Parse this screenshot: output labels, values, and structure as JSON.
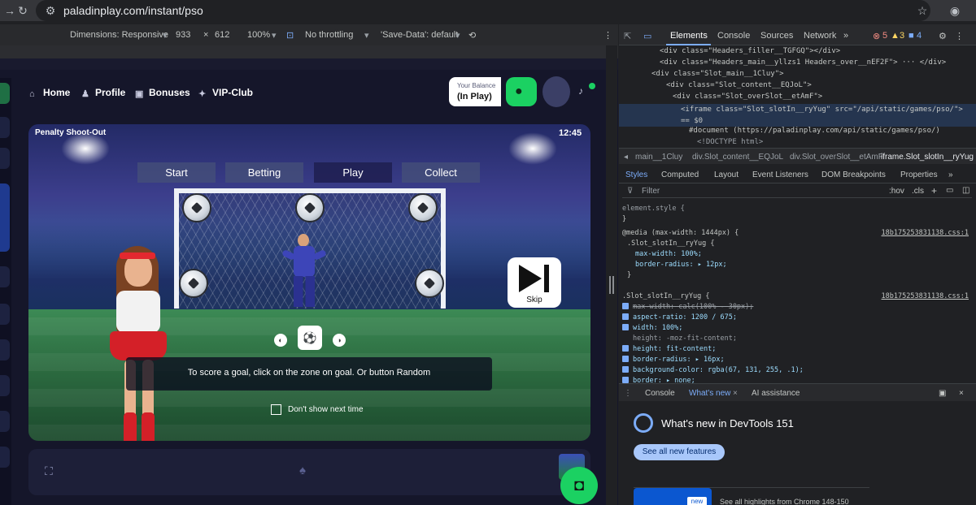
{
  "browser": {
    "url": "paladinplay.com/instant/pso"
  },
  "device_toolbar": {
    "dimensions_label": "Dimensions: Responsive",
    "width": "933",
    "times": "×",
    "height": "612",
    "zoom": "100%",
    "throttling": "No throttling",
    "save_data": "'Save-Data': default"
  },
  "site_nav": {
    "items": [
      {
        "label": "Home",
        "icon": "home-icon"
      },
      {
        "label": "Profile",
        "icon": "user-icon"
      },
      {
        "label": "Bonuses",
        "icon": "gift-icon"
      },
      {
        "label": "VIP-Club",
        "icon": "star-icon"
      }
    ],
    "balance_caption": "Your Balance",
    "balance_value": "(In Play)"
  },
  "game": {
    "title": "Penalty Shoot-Out",
    "time": "12:45",
    "tabs": [
      "Start",
      "Betting",
      "Play",
      "Collect"
    ],
    "active_tab": "Play",
    "skip_label": "Skip",
    "instruction": "To score a goal, click on the zone on goal. Or button Random",
    "dont_show_label": "Don't show next time"
  },
  "devtools": {
    "tabs": [
      "Elements",
      "Console",
      "Sources",
      "Network",
      "»"
    ],
    "error_count": "5",
    "warning_count": "3",
    "info_count": "4",
    "dom_lines": [
      "<div class=\"Headers_filler__TGFGQ\"></div>",
      "<div class=\"Headers_main__yllzs1 Headers_over__nEF2F\"> ··· </div>",
      "<div class=\"Slot_main__1Cluy\">",
      "<div class=\"Slot_content__EQJoL\">",
      "<div class=\"Slot_overSlot__etAmF\">",
      "<iframe class=\"Slot_slotIn__ryYug\" src=\"/api/static/games/pso/\"> == $0",
      "#document (https://paladinplay.com/api/static/games/pso/)",
      "<!DOCTYPE html>"
    ],
    "breadcrumbs": [
      "main__1Cluy",
      "div.Slot_content__EQJoL",
      "div.Slot_overSlot__etAmF",
      "iframe.Slot_slotIn__ryYug"
    ],
    "styles_tabs": [
      "Styles",
      "Computed",
      "Layout",
      "Event Listeners",
      "DOM Breakpoints",
      "Properties",
      "»"
    ],
    "filter_placeholder": "Filter",
    "filter_extras": [
      ":hov",
      ".cls",
      "+"
    ],
    "rules": [
      "element.style {",
      "}",
      "@media (max-width: 1444px) {",
      ".Slot_slotIn__ryYug {",
      "max-width: 100%;",
      "border-radius: ▸ 12px;",
      "}",
      ".Slot_slotIn__ryYug {",
      "max-width: calc(100% - 30px);",
      "aspect-ratio: 1200 / 675;",
      "width: 100%;",
      "height: -moz-fit-content;",
      "height: fit-content;",
      "border-radius: ▸ 16px;",
      "background-color: rgba(67, 131, 255, .1);",
      "border: ▸ none;"
    ],
    "rule_source": "18b1752538311​38.css:1",
    "drawer_tabs": [
      "Console",
      "What's new",
      "AI assistance"
    ],
    "whats_new_title": "What's new in DevTools 151",
    "see_all": "See all new features",
    "card_badge": "new",
    "card_text": "See all highlights from Chrome 148-150"
  }
}
